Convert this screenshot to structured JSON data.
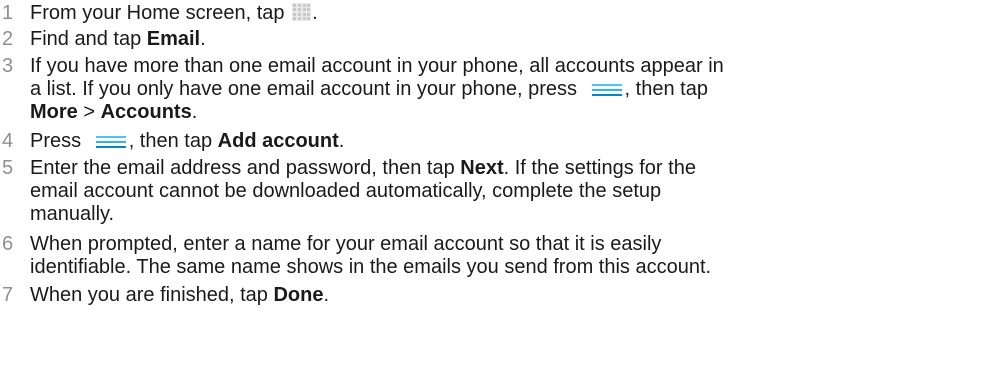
{
  "steps": [
    {
      "num": "1",
      "lines": [
        {
          "t1": "From your Home screen, tap ",
          "icon": "apps-grid-icon",
          "t2": "."
        }
      ]
    },
    {
      "num": "2",
      "lines": [
        {
          "t1": "Find and tap ",
          "b1": "Email",
          "t2": "."
        }
      ]
    },
    {
      "num": "3",
      "lines": [
        {
          "t1": "If you have more than one email account in your phone, all accounts appear in"
        },
        {
          "t1": "a list. If you only have one email account in your phone, press ",
          "icon": "menu-icon",
          "t2": ", then tap"
        },
        {
          "b1": "More",
          "t1": " > ",
          "b2": "Accounts",
          "t2": "."
        }
      ]
    },
    {
      "num": "4",
      "lines": [
        {
          "t1": "Press ",
          "icon": "menu-icon",
          "t2": ", then tap ",
          "b1": "Add account",
          "t3": "."
        }
      ]
    },
    {
      "num": "5",
      "lines": [
        {
          "t1": "Enter the email address and password, then tap ",
          "b1": "Next",
          "t2": ". If the settings for the"
        },
        {
          "t1": "email account cannot be downloaded automatically, complete the setup"
        },
        {
          "t1": "manually."
        }
      ]
    },
    {
      "num": "6",
      "lines": [
        {
          "t1": "When prompted, enter a name for your email account so that it is easily"
        },
        {
          "t1": "identifiable. The same name shows in the emails you send from this account."
        }
      ]
    },
    {
      "num": "7",
      "lines": [
        {
          "t1": "When you are finished, tap ",
          "b1": "Done",
          "t2": "."
        }
      ]
    }
  ],
  "colors": {
    "step_number": "#8f8f8f",
    "text": "#1a1a1a",
    "menu_icon": "#29b6f6",
    "apps_icon": "#cfcfcf"
  }
}
